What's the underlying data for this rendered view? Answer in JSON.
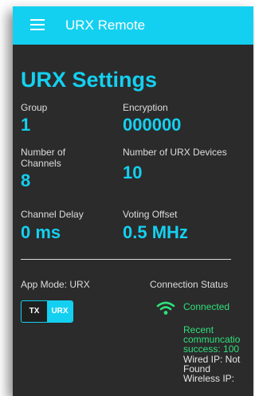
{
  "app": {
    "title": "URX Remote"
  },
  "settings": {
    "title": "URX Settings",
    "group": {
      "label": "Group",
      "value": "1"
    },
    "encryption": {
      "label": "Encryption",
      "value": "000000"
    },
    "channels": {
      "label_line1": "Number of",
      "label_line2": "Channels",
      "value": "8"
    },
    "devices": {
      "label": "Number of URX Devices",
      "value": "10"
    },
    "channel_delay": {
      "label": "Channel Delay",
      "value": "0 ms"
    },
    "voting_offset": {
      "label": "Voting Offset",
      "value": "0.5 MHz"
    }
  },
  "mode": {
    "label": "App Mode: URX",
    "toggle_tx": "TX",
    "toggle_urx": "URX",
    "selected": "URX"
  },
  "connection": {
    "label": "Connection Status",
    "icon": "wifi-icon",
    "status": "Connected",
    "recent_line1": "Recent",
    "recent_line2": "communcatio",
    "recent_line3": "success: 100",
    "wired_line1": "Wired IP: Not",
    "wired_line2": "Found",
    "wireless_line1": "Wireless IP:"
  },
  "colors": {
    "accent": "#14d0f0",
    "background": "#2b2b2b",
    "success": "#2fe07a"
  }
}
